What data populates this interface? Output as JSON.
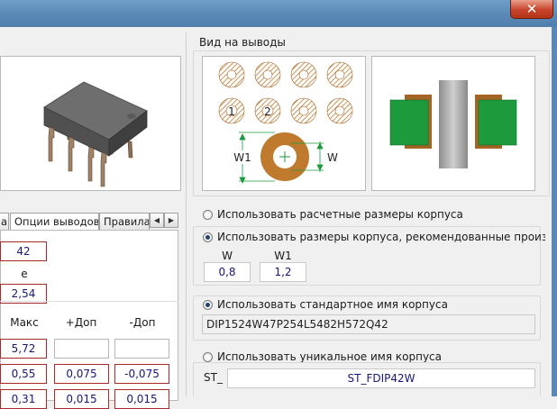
{
  "window": {
    "close_label": "✕"
  },
  "left": {
    "tabs": [
      {
        "label": "а"
      },
      {
        "label": "Опции выводов"
      },
      {
        "label": "Правила"
      }
    ],
    "scroll_left": "◀",
    "scroll_right": "▶",
    "field_top": "42",
    "label_e": "e",
    "field_e": "2,54",
    "col_headers": {
      "max": "Макс",
      "plus": "+Доп",
      "minus": "-Доп"
    },
    "rows": [
      {
        "max": "5,72",
        "plus": "",
        "minus": ""
      },
      {
        "max": "0,55",
        "plus": "0,075",
        "minus": "-0,075"
      },
      {
        "max": "0,31",
        "plus": "0,015",
        "minus": "0,015"
      }
    ]
  },
  "right": {
    "pin_view_title": "Вид на выводы",
    "pins": {
      "pin1": "1",
      "pin2": "2",
      "dim_w1": "W1",
      "dim_w": "W"
    },
    "options": [
      {
        "label": "Использовать расчетные размеры корпуса",
        "selected": false
      },
      {
        "label": "Использовать размеры корпуса, рекомендованные производителем",
        "selected": true
      },
      {
        "label": "Использовать стандартное имя корпуса",
        "selected": true
      },
      {
        "label": "Использовать уникальное имя корпуса",
        "selected": false
      }
    ],
    "dims": {
      "w_label": "W",
      "w1_label": "W1",
      "w_value": "0,8",
      "w1_value": "1,2"
    },
    "standard_name": "DIP1524W47P254L5482H572Q42",
    "unique_prefix": "ST_",
    "unique_name": "ST_FDIP42W"
  },
  "colors": {
    "accent_red": "#a52a2a",
    "value_blue": "#17177a",
    "copper": "#c07a2e",
    "pcb_green": "#1d9a3c"
  }
}
